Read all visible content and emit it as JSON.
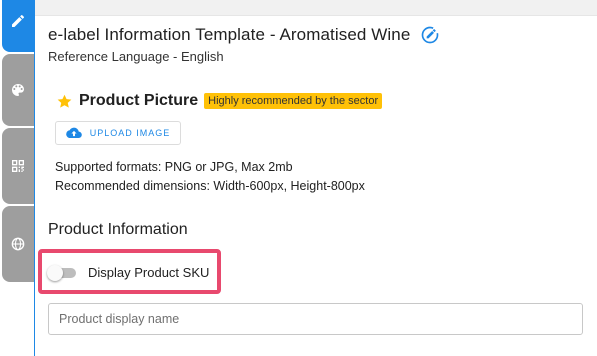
{
  "template": {
    "title": "e-label Information Template - Aromatised Wine",
    "subtitle": "Reference Language - English"
  },
  "product_picture": {
    "title": "Product Picture",
    "badge": "Highly recommended by the sector",
    "upload_label": "UPLOAD IMAGE",
    "formats": "Supported formats: PNG or JPG, Max 2mb",
    "dimensions": "Recommended dimensions: Width-600px, Height-800px"
  },
  "product_information": {
    "title": "Product Information",
    "sku_toggle_label": "Display Product SKU",
    "sku_toggle_on": false,
    "display_name_placeholder": "Product display name",
    "display_name_value": ""
  },
  "sidebar_tabs": [
    {
      "name": "edit",
      "icon": "pencil-icon",
      "active": true
    },
    {
      "name": "design",
      "icon": "palette-icon",
      "active": false
    },
    {
      "name": "qr",
      "icon": "qr-code-icon",
      "active": false
    },
    {
      "name": "language",
      "icon": "globe-icon",
      "active": false
    }
  ],
  "colors": {
    "accent": "#1e88e5",
    "badge": "#ffc107",
    "star": "#ffc107",
    "highlight_border": "#e8496e",
    "rail_inactive": "#9e9e9e"
  }
}
